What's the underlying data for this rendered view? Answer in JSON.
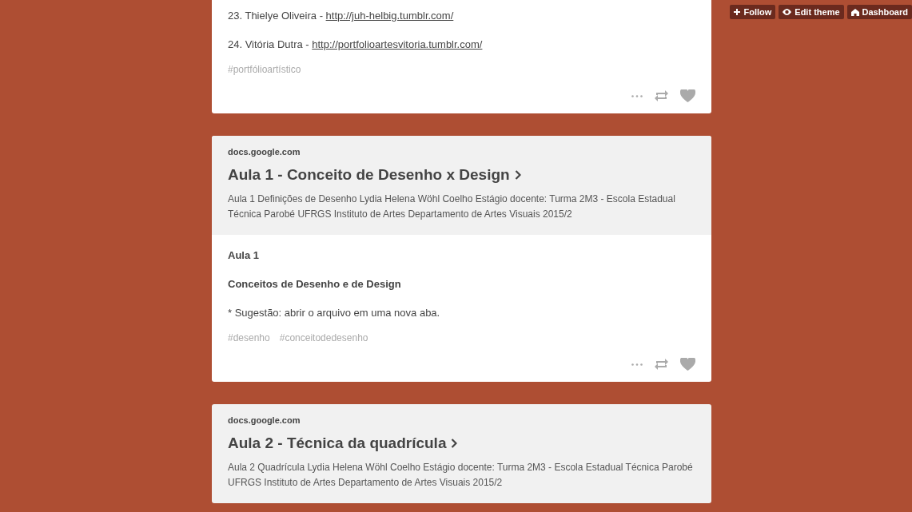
{
  "top_controls": [
    {
      "kind": "follow",
      "label": "Follow"
    },
    {
      "kind": "edit",
      "label": "Edit theme"
    },
    {
      "kind": "dashboard",
      "label": "Dashboard"
    }
  ],
  "posts": [
    {
      "kind": "text",
      "cut_top": true,
      "paragraphs": [
        {
          "text": "23. Thielye Oliveira - ",
          "link": "http://juh-helbig.tumblr.com/"
        },
        {
          "text": "24. Vitória Dutra - ",
          "link": "http://portfolioartesvitoria.tumblr.com/"
        }
      ],
      "tags": [
        "#portfólioartístico"
      ]
    },
    {
      "kind": "link",
      "source": "docs.google.com",
      "title": "Aula 1 - Conceito de Desenho x Design",
      "description": "Aula 1 Definições de Desenho Lydia Helena Wöhl Coelho Estágio docente: Turma 2M3 - Escola Estadual Técnica Parobé UFRGS Instituto de Artes Departamento de Artes Visuais 2015/2",
      "body": [
        {
          "text": "Aula 1",
          "bold": true
        },
        {
          "text": "Conceitos de Desenho e de Design",
          "bold": true
        },
        {
          "text": "* Sugestão: abrir o arquivo em uma nova aba.",
          "bold": false
        }
      ],
      "tags": [
        "#desenho",
        "#conceitodedesenho"
      ]
    },
    {
      "kind": "link",
      "source": "docs.google.com",
      "title": "Aula 2 - Técnica da quadrícula",
      "description": "Aula 2 Quadrícula Lydia Helena Wöhl Coelho Estágio docente: Turma 2M3 - Escola Estadual Técnica Parobé UFRGS Instituto de Artes Departamento de Artes Visuais 2015/2"
    }
  ]
}
